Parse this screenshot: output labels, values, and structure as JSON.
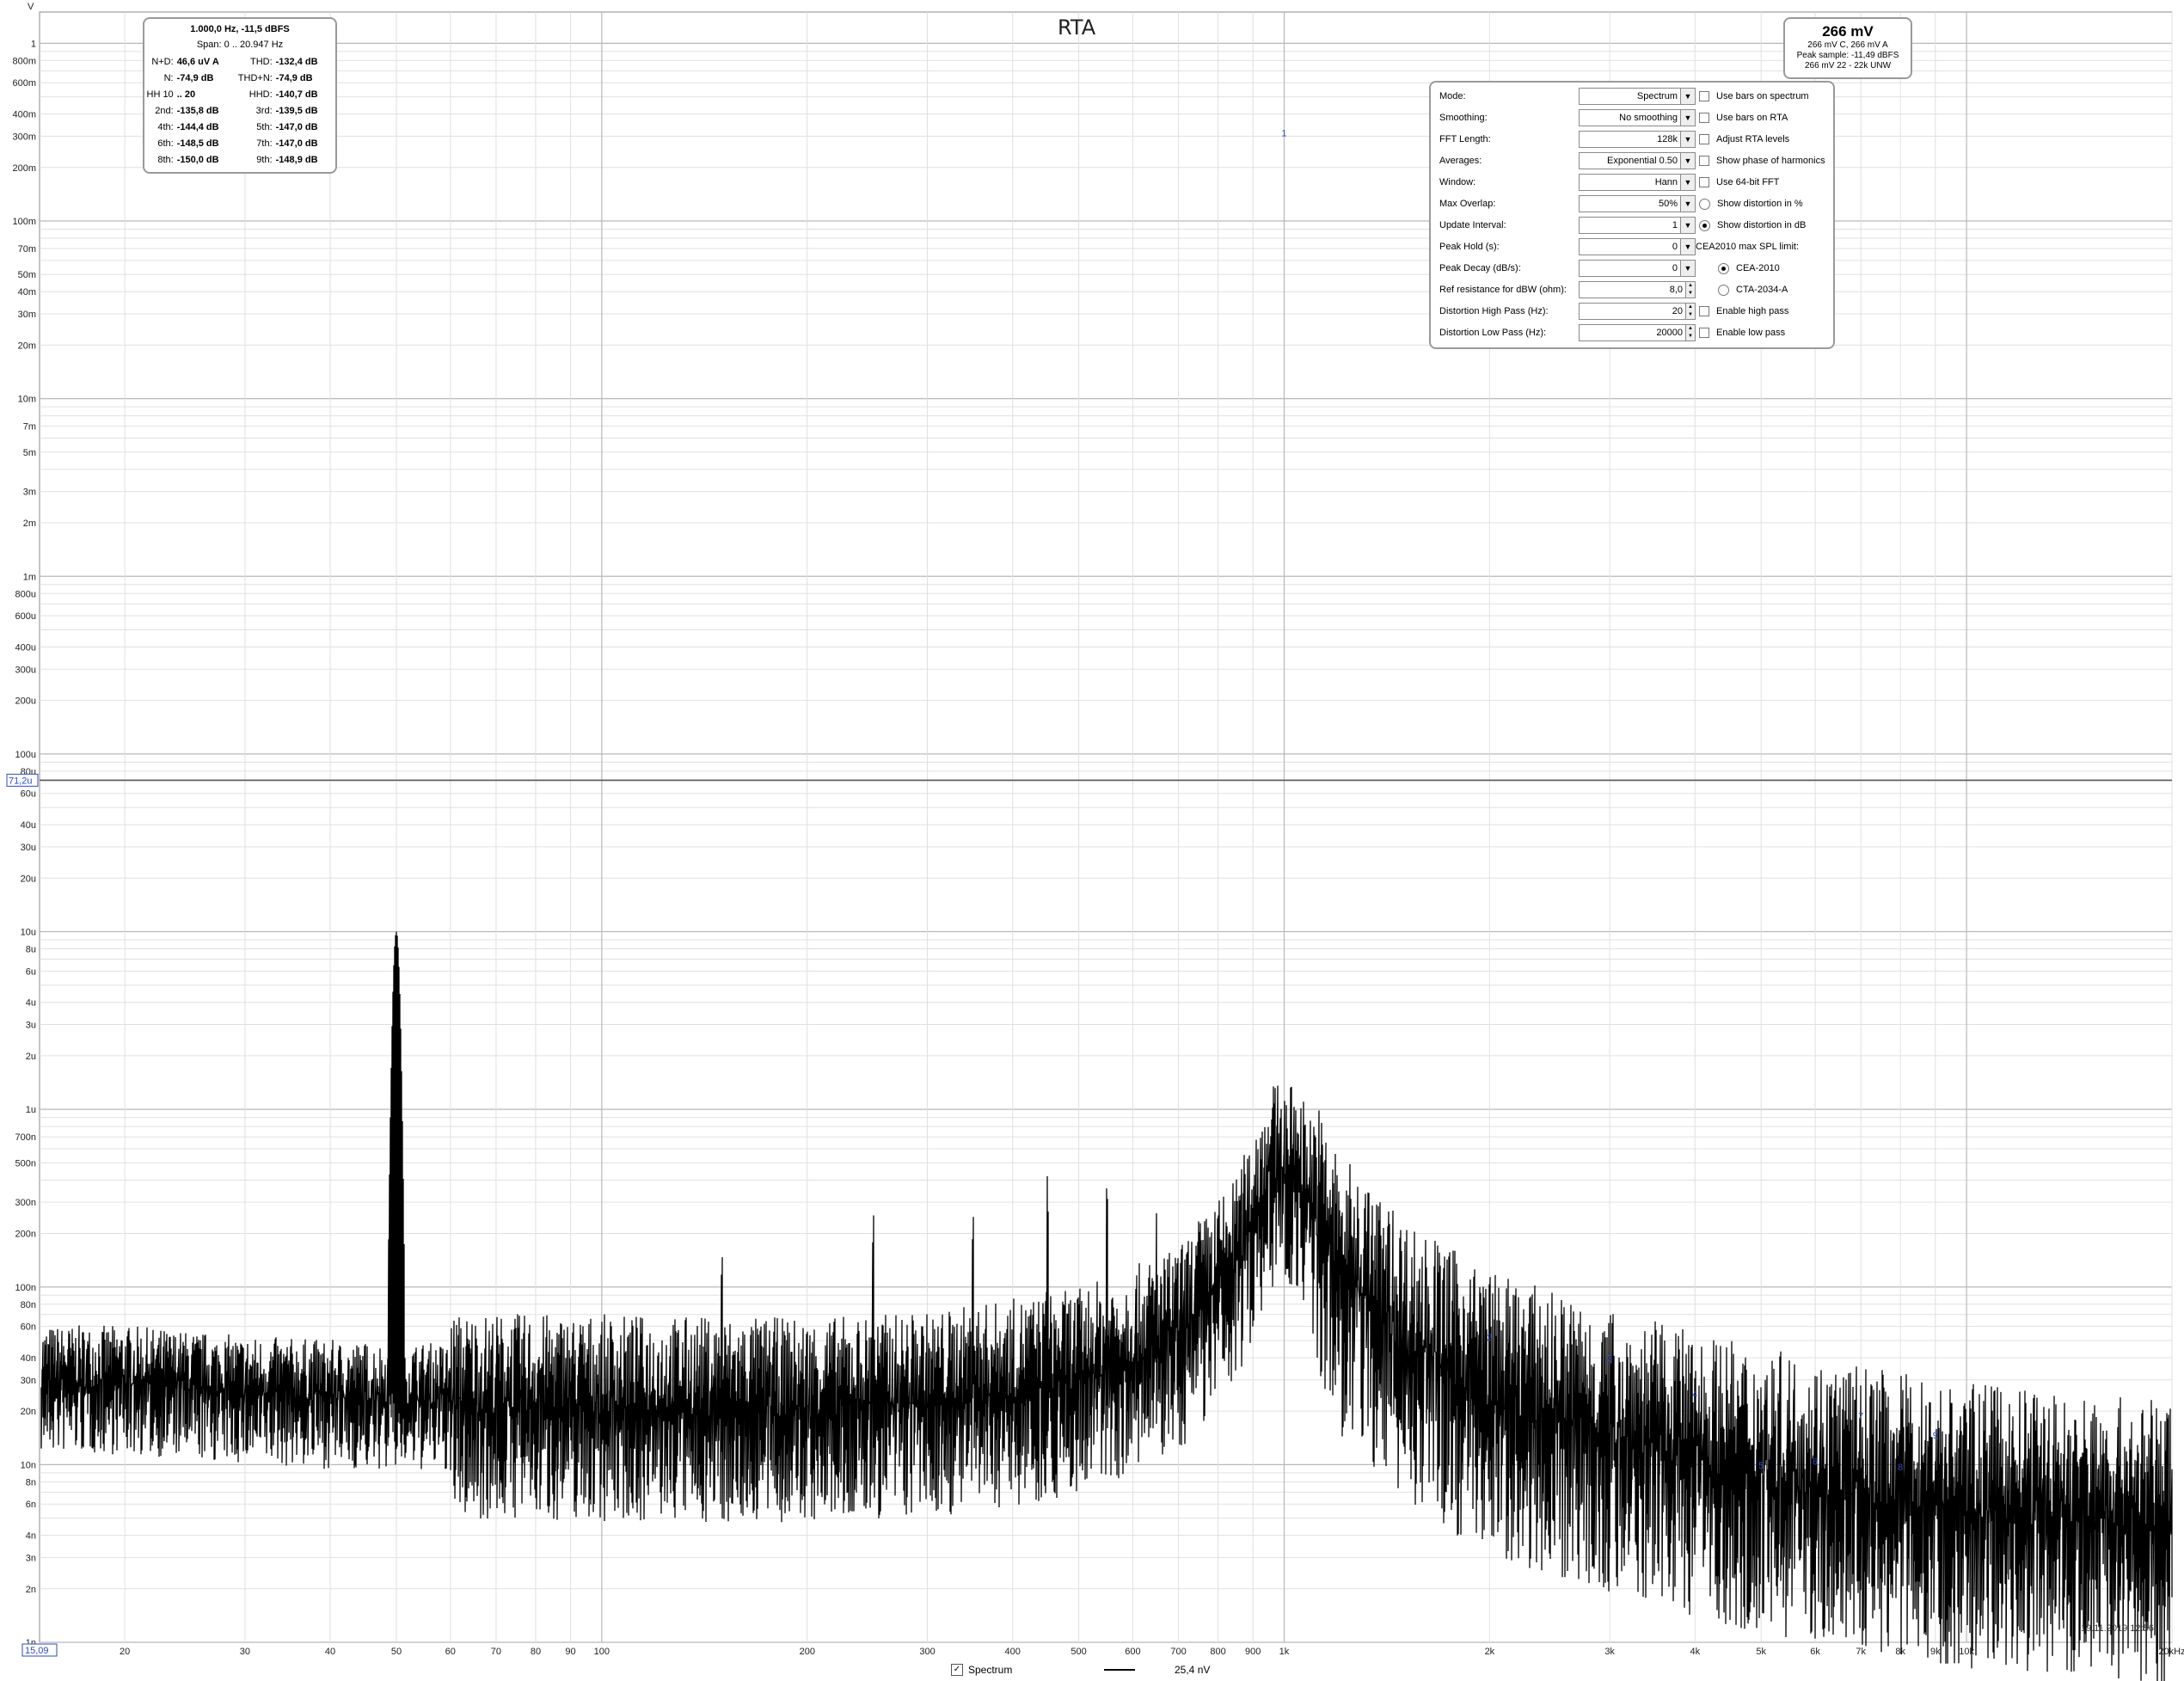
{
  "chart_data": {
    "type": "line",
    "title": "RTA",
    "ylabel": "V",
    "xunit": "kHz",
    "xscale": "log",
    "yscale": "log",
    "xlim": [
      15,
      20000
    ],
    "ylim": [
      1e-09,
      1.5
    ],
    "grid": true,
    "cursor": {
      "y": 7.12e-05,
      "y_label": "71,2u",
      "x_label": "15,09"
    },
    "x_ticks": [
      {
        "v": 20,
        "label": "20"
      },
      {
        "v": 30,
        "label": "30"
      },
      {
        "v": 40,
        "label": "40"
      },
      {
        "v": 50,
        "label": "50"
      },
      {
        "v": 60,
        "label": "60"
      },
      {
        "v": 70,
        "label": "70"
      },
      {
        "v": 80,
        "label": "80"
      },
      {
        "v": 90,
        "label": "90"
      },
      {
        "v": 100,
        "label": "100"
      },
      {
        "v": 200,
        "label": "200"
      },
      {
        "v": 300,
        "label": "300"
      },
      {
        "v": 400,
        "label": "400"
      },
      {
        "v": 500,
        "label": "500"
      },
      {
        "v": 600,
        "label": "600"
      },
      {
        "v": 700,
        "label": "700"
      },
      {
        "v": 800,
        "label": "800"
      },
      {
        "v": 900,
        "label": "900"
      },
      {
        "v": 1000,
        "label": "1k"
      },
      {
        "v": 2000,
        "label": "2k"
      },
      {
        "v": 3000,
        "label": "3k"
      },
      {
        "v": 4000,
        "label": "4k"
      },
      {
        "v": 5000,
        "label": "5k"
      },
      {
        "v": 6000,
        "label": "6k"
      },
      {
        "v": 7000,
        "label": "7k"
      },
      {
        "v": 8000,
        "label": "8k"
      },
      {
        "v": 9000,
        "label": "9k"
      },
      {
        "v": 10000,
        "label": "10k"
      },
      {
        "v": 20000,
        "label": "20kHz"
      }
    ],
    "y_ticks": [
      {
        "v": 1,
        "label": "1"
      },
      {
        "v": 0.8,
        "label": "800m"
      },
      {
        "v": 0.6,
        "label": "600m"
      },
      {
        "v": 0.4,
        "label": "400m"
      },
      {
        "v": 0.3,
        "label": "300m"
      },
      {
        "v": 0.2,
        "label": "200m"
      },
      {
        "v": 0.1,
        "label": "100m"
      },
      {
        "v": 0.07,
        "label": "70m"
      },
      {
        "v": 0.05,
        "label": "50m"
      },
      {
        "v": 0.04,
        "label": "40m"
      },
      {
        "v": 0.03,
        "label": "30m"
      },
      {
        "v": 0.02,
        "label": "20m"
      },
      {
        "v": 0.01,
        "label": "10m"
      },
      {
        "v": 0.007,
        "label": "7m"
      },
      {
        "v": 0.005,
        "label": "5m"
      },
      {
        "v": 0.003,
        "label": "3m"
      },
      {
        "v": 0.002,
        "label": "2m"
      },
      {
        "v": 0.001,
        "label": "1m"
      },
      {
        "v": 0.0008,
        "label": "800u"
      },
      {
        "v": 0.0006,
        "label": "600u"
      },
      {
        "v": 0.0004,
        "label": "400u"
      },
      {
        "v": 0.0003,
        "label": "300u"
      },
      {
        "v": 0.0002,
        "label": "200u"
      },
      {
        "v": 0.0001,
        "label": "100u"
      },
      {
        "v": 8e-05,
        "label": "80u"
      },
      {
        "v": 6e-05,
        "label": "60u"
      },
      {
        "v": 4e-05,
        "label": "40u"
      },
      {
        "v": 3e-05,
        "label": "30u"
      },
      {
        "v": 2e-05,
        "label": "20u"
      },
      {
        "v": 1e-05,
        "label": "10u"
      },
      {
        "v": 8e-06,
        "label": "8u"
      },
      {
        "v": 6e-06,
        "label": "6u"
      },
      {
        "v": 4e-06,
        "label": "4u"
      },
      {
        "v": 3e-06,
        "label": "3u"
      },
      {
        "v": 2e-06,
        "label": "2u"
      },
      {
        "v": 1e-06,
        "label": "1u"
      },
      {
        "v": 7e-07,
        "label": "700n"
      },
      {
        "v": 5e-07,
        "label": "500n"
      },
      {
        "v": 3e-07,
        "label": "300n"
      },
      {
        "v": 2e-07,
        "label": "200n"
      },
      {
        "v": 1e-07,
        "label": "100n"
      },
      {
        "v": 8e-08,
        "label": "80n"
      },
      {
        "v": 6e-08,
        "label": "60n"
      },
      {
        "v": 4e-08,
        "label": "40n"
      },
      {
        "v": 3e-08,
        "label": "30n"
      },
      {
        "v": 2e-08,
        "label": "20n"
      },
      {
        "v": 1e-08,
        "label": "10n"
      },
      {
        "v": 8e-09,
        "label": "8n"
      },
      {
        "v": 6e-09,
        "label": "6n"
      },
      {
        "v": 4e-09,
        "label": "4n"
      },
      {
        "v": 3e-09,
        "label": "3n"
      },
      {
        "v": 2e-09,
        "label": "2n"
      },
      {
        "v": 1e-09,
        "label": "1n"
      }
    ],
    "series": [
      {
        "name": "Spectrum",
        "color": "#000000",
        "noise_floor_points": [
          [
            15,
            3.2e-08
          ],
          [
            20,
            3.2e-08
          ],
          [
            30,
            2.8e-08
          ],
          [
            45,
            2.6e-08
          ],
          [
            100,
            2.5e-08
          ],
          [
            200,
            2.4e-08
          ],
          [
            300,
            2.6e-08
          ],
          [
            500,
            3.5e-08
          ],
          [
            700,
            6e-08
          ],
          [
            850,
            1.5e-07
          ],
          [
            950,
            5e-07
          ],
          [
            1000,
            0.266
          ],
          [
            1050,
            5e-07
          ],
          [
            1200,
            1.4e-07
          ],
          [
            1500,
            6e-08
          ],
          [
            2000,
            3e-08
          ],
          [
            3000,
            1.8e-08
          ],
          [
            5000,
            1.1e-08
          ],
          [
            10000,
            7e-09
          ],
          [
            20000,
            5.5e-09
          ]
        ],
        "peaks": [
          [
            50,
            1e-05
          ],
          [
            150,
            1.7e-07
          ],
          [
            250,
            2.8e-07
          ],
          [
            350,
            2.8e-07
          ],
          [
            450,
            4.5e-07
          ],
          [
            550,
            4.3e-07
          ],
          [
            650,
            2.6e-07
          ],
          [
            750,
            2.6e-07
          ],
          [
            850,
            2.8e-07
          ],
          [
            950,
            4.5e-07
          ]
        ],
        "fundamental": [
          1000,
          0.266
        ]
      }
    ],
    "harmonic_markers": [
      {
        "n": "1",
        "x": 1000,
        "y": 0.3
      },
      {
        "n": "2",
        "x": 2000,
        "y": 5e-08
      },
      {
        "n": "3",
        "x": 3000,
        "y": 3.8e-08
      },
      {
        "n": "4",
        "x": 4000,
        "y": 2.4e-08
      },
      {
        "n": "5",
        "x": 5000,
        "y": 9.5e-09
      },
      {
        "n": "6",
        "x": 6000,
        "y": 1e-08
      },
      {
        "n": "7",
        "x": 7000,
        "y": 1.8e-08
      },
      {
        "n": "8",
        "x": 8000,
        "y": 9.3e-09
      },
      {
        "n": "9",
        "x": 9000,
        "y": 1.4e-08
      }
    ]
  },
  "stats": {
    "header": "1.000,0 Hz, -11,5 dBFS",
    "span": "Span:  0 .. 20.947 Hz",
    "rows": [
      {
        "l1": "N+D:",
        "v1": "46,6 uV A",
        "l2": "THD:",
        "v2": "-132,4 dB"
      },
      {
        "l1": "N:",
        "v1": "-74,9 dB",
        "l2": "THD+N:",
        "v2": "-74,9 dB"
      },
      {
        "l1": "HH 10",
        "v1": ".. 20",
        "l2": "HHD:",
        "v2": "-140,7 dB"
      },
      {
        "l1": "2nd:",
        "v1": "-135,8 dB",
        "l2": "3rd:",
        "v2": "-139,5 dB"
      },
      {
        "l1": "4th:",
        "v1": "-144,4 dB",
        "l2": "5th:",
        "v2": "-147,0 dB"
      },
      {
        "l1": "6th:",
        "v1": "-148,5 dB",
        "l2": "7th:",
        "v2": "-147,0 dB"
      },
      {
        "l1": "8th:",
        "v1": "-150,0 dB",
        "l2": "9th:",
        "v2": "-148,9 dB"
      }
    ]
  },
  "level": {
    "main": "266 mV",
    "line1": "266 mV C, 266 mV A",
    "line2": "Peak sample: -11,49 dBFS",
    "line3": "266 mV 22 - 22k UNW"
  },
  "settings": {
    "rows": [
      {
        "label": "Mode:",
        "value": "Spectrum",
        "ctl": "dropdown"
      },
      {
        "label": "Smoothing:",
        "value": "No  smoothing",
        "ctl": "dropdown"
      },
      {
        "label": "FFT Length:",
        "value": "128k",
        "ctl": "dropdown"
      },
      {
        "label": "Averages:",
        "value": "Exponential 0.50",
        "ctl": "dropdown"
      },
      {
        "label": "Window:",
        "value": "Hann",
        "ctl": "dropdown"
      },
      {
        "label": "Max Overlap:",
        "value": "50%",
        "ctl": "dropdown"
      },
      {
        "label": "Update Interval:",
        "value": "1",
        "ctl": "dropdown"
      },
      {
        "label": "Peak Hold (s):",
        "value": "0",
        "ctl": "dropdown"
      },
      {
        "label": "Peak Decay (dB/s):",
        "value": "0",
        "ctl": "dropdown"
      },
      {
        "label": "Ref resistance for dBW (ohm):",
        "value": "8,0",
        "ctl": "spinner"
      },
      {
        "label": "Distortion High Pass (Hz):",
        "value": "20",
        "ctl": "spinner"
      },
      {
        "label": "Distortion Low Pass (Hz):",
        "value": "20000",
        "ctl": "spinner"
      }
    ],
    "options": [
      {
        "label": "Use bars on spectrum",
        "kind": "checkbox",
        "checked": false
      },
      {
        "label": "Use bars on RTA",
        "kind": "checkbox",
        "checked": false
      },
      {
        "label": "Adjust RTA levels",
        "kind": "checkbox",
        "checked": false
      },
      {
        "label": "Show phase of harmonics",
        "kind": "checkbox",
        "checked": false
      },
      {
        "label": "Use 64-bit FFT",
        "kind": "checkbox",
        "checked": false
      },
      {
        "label": "Show distortion in %",
        "kind": "radio",
        "checked": false
      },
      {
        "label": "Show distortion in dB",
        "kind": "radio",
        "checked": true
      },
      {
        "label": "CEA2010 max SPL limit:",
        "kind": "label",
        "checked": false
      },
      {
        "label": "CEA-2010",
        "kind": "radio-indent",
        "checked": true
      },
      {
        "label": "CTA-2034-A",
        "kind": "radio-indent",
        "checked": false
      },
      {
        "label": "Enable high pass",
        "kind": "checkbox",
        "checked": false
      },
      {
        "label": "Enable low pass",
        "kind": "checkbox",
        "checked": false
      }
    ]
  },
  "timestamp": "19.11.2019 12:56",
  "legend": {
    "checkbox_label": "Spectrum",
    "value": "25,4 nV"
  }
}
